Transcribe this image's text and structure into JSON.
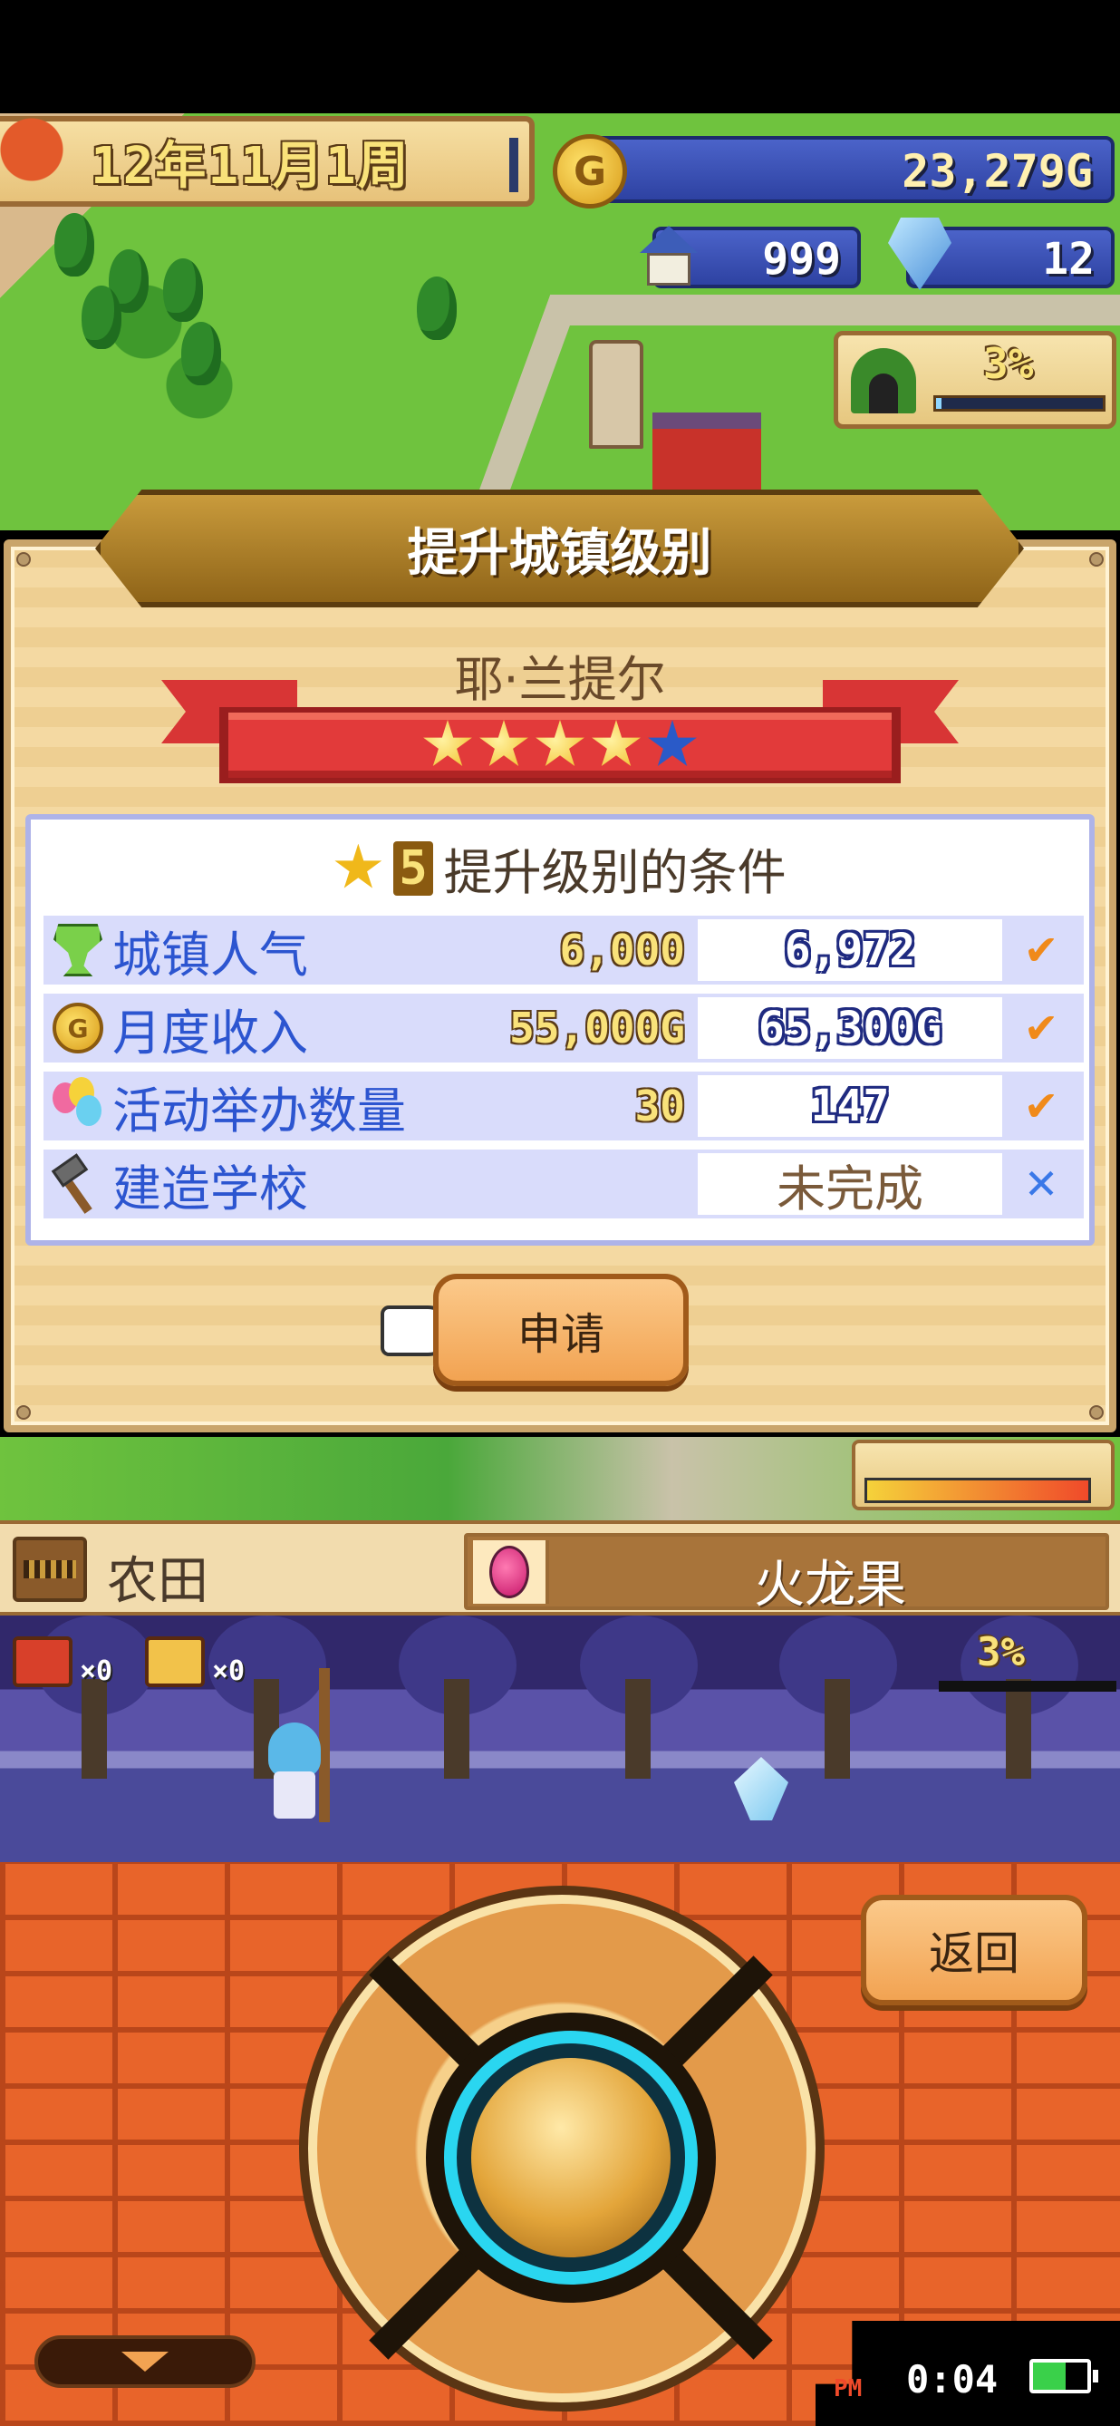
{
  "header": {
    "date": "12年11月1周",
    "money": "23,279G",
    "population": "999",
    "gems": "12",
    "exploration_percent": "3%",
    "exploration_progress": 0.03
  },
  "dialog": {
    "title": "提升城镇级别",
    "town_name": "耶·兰提尔",
    "stars_filled": 4,
    "stars_total": 5,
    "conditions_header": {
      "level": "5",
      "text": "提升级别的条件"
    },
    "conditions": [
      {
        "icon": "trophy-icon",
        "label": "城镇人气",
        "required": "6,000",
        "current": "6,972",
        "met": true
      },
      {
        "icon": "coin-icon",
        "label": "月度收入",
        "required": "55,000G",
        "current": "65,300G",
        "met": true
      },
      {
        "icon": "balloons-icon",
        "label": "活动举办数量",
        "required": "30",
        "current": "147",
        "met": true
      },
      {
        "icon": "hammer-icon",
        "label": "建造学校",
        "required": "",
        "current": "未完成",
        "met": false
      }
    ],
    "apply_label": "申请",
    "check_mark": "✔",
    "cross_mark": "✕"
  },
  "info_bar": {
    "facility": "农田",
    "item": "火龙果"
  },
  "forest": {
    "red_chest_count": "×0",
    "gold_chest_count": "×0",
    "percent": "3%"
  },
  "controls": {
    "back_label": "返回"
  },
  "status": {
    "ampm": "PM",
    "time": "0:04",
    "battery_level": 0.6
  }
}
